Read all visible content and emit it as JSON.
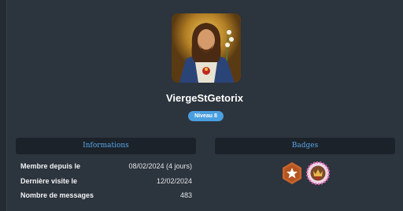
{
  "profile": {
    "username": "ViergeStGetorix",
    "level": "Niveau 8",
    "avatar_icon": "religious-portrait-avatar"
  },
  "informations": {
    "title": "Informations",
    "rows": [
      {
        "label": "Membre depuis le",
        "value": "08/02/2024 (4 jours)"
      },
      {
        "label": "Dernière visite le",
        "value": "12/02/2024"
      },
      {
        "label": "Nombre de messages",
        "value": "483"
      }
    ]
  },
  "badges": {
    "title": "Badges",
    "items": [
      {
        "icon": "star-hexagon-badge-icon",
        "color": "#c8642d"
      },
      {
        "icon": "crowned-round-badge-icon",
        "color": "#d25aa6"
      }
    ]
  },
  "colors": {
    "background": "#252b33",
    "card": "#2c343d",
    "panel_header": "#1b2229",
    "accent_blue": "#5aa6e8",
    "level_badge": "#4a9fe0"
  }
}
